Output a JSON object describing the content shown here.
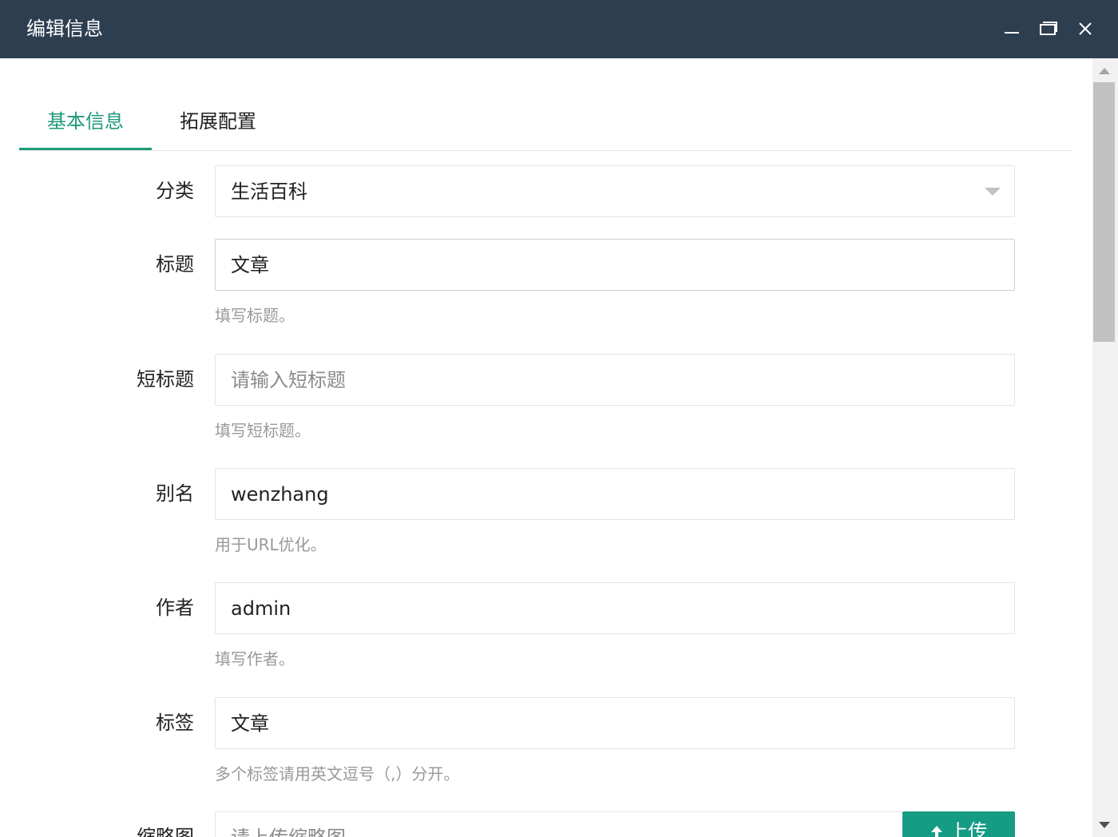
{
  "window": {
    "title": "编辑信息",
    "minimize_icon": "minimize-icon",
    "maximize_icon": "maximize-icon",
    "close_icon": "close-icon"
  },
  "tabs": [
    {
      "label": "基本信息",
      "active": true
    },
    {
      "label": "拓展配置",
      "active": false
    }
  ],
  "form": {
    "category": {
      "label": "分类",
      "value": "生活百科"
    },
    "title": {
      "label": "标题",
      "value": "文章",
      "hint": "填写标题。"
    },
    "short_title": {
      "label": "短标题",
      "value": "",
      "placeholder": "请输入短标题",
      "hint": "填写短标题。"
    },
    "alias": {
      "label": "别名",
      "value": "wenzhang",
      "hint": "用于URL优化。"
    },
    "author": {
      "label": "作者",
      "value": "admin",
      "hint": "填写作者。"
    },
    "tags": {
      "label": "标签",
      "value": "文章",
      "hint": "多个标签请用英文逗号（,）分开。"
    },
    "thumbnail": {
      "label": "缩略图",
      "placeholder": "请上传缩略图",
      "upload_label": "上传",
      "upload_icon": "arrow-up-icon"
    }
  },
  "colors": {
    "titlebar": "#2e3e51",
    "accent": "#1e9a7a",
    "upload_button": "#169b85"
  }
}
